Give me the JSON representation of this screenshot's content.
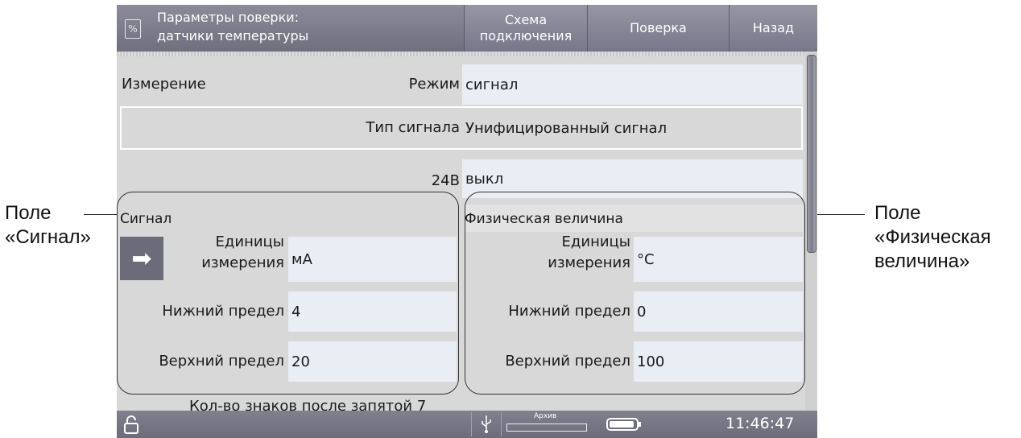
{
  "header": {
    "title": "Параметры поверки:\nдатчики температуры",
    "icon": "percent-document-icon",
    "buttons": {
      "scheme": "Схема\nподключения",
      "verify": "Поверка",
      "back": "Назад"
    }
  },
  "rows": {
    "measurement_label": "Измерение",
    "mode_label": "Режим",
    "mode_value": "сигнал",
    "signal_type_label": "Тип сигнала",
    "signal_type_value": "Унифицированный сигнал",
    "power_label": "24В",
    "power_value": "выкл",
    "decimals_label": "Кол-во знаков после запятой",
    "decimals_value": "7"
  },
  "signal_group": {
    "title": "Сигнал",
    "units_label_line1": "Единицы",
    "units_label_line2": "измерения",
    "units_value": "мА",
    "lower_label": "Нижний предел",
    "lower_value": "4",
    "upper_label": "Верхний предел",
    "upper_value": "20",
    "arrow_icon": "right-arrow-icon"
  },
  "phys_group": {
    "title": "Физическая величина",
    "units_label_line1": "Единицы",
    "units_label_line2": "измерения",
    "units_value": "°C",
    "lower_label": "Нижний предел",
    "lower_value": "0",
    "upper_label": "Верхний предел",
    "upper_value": "100"
  },
  "status": {
    "archive_label": "Архив",
    "time": "11:46:47",
    "lock_icon": "unlock-icon",
    "usb_icon": "usb-icon",
    "battery_icon": "battery-icon"
  },
  "callouts": {
    "left": "Поле\n«Сигнал»",
    "right": "Поле\n«Физическая\nвеличина»"
  },
  "colors": {
    "header": "#7b7b89",
    "field": "#e9eef4",
    "content_bg": "#d8d8d8"
  }
}
